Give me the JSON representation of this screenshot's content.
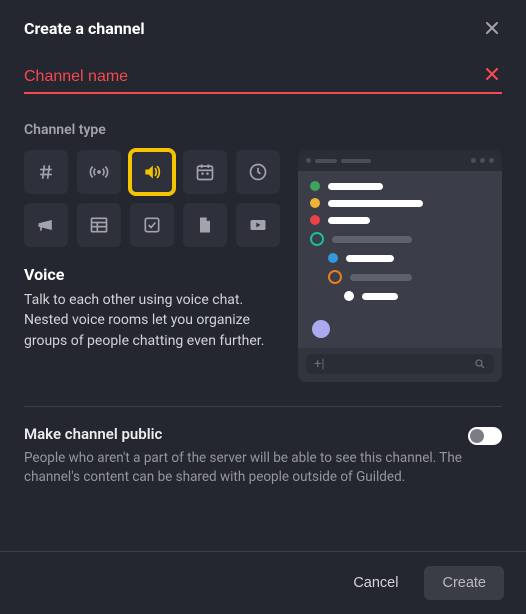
{
  "header": {
    "title": "Create a channel"
  },
  "name_input": {
    "placeholder": "Channel name",
    "value": ""
  },
  "section": {
    "channel_type_label": "Channel type"
  },
  "selected_type": {
    "title": "Voice",
    "description": "Talk to each other using voice chat. Nested voice rooms let you organize groups of people chatting even further."
  },
  "type_icons": [
    "hash-icon",
    "broadcast-icon",
    "voice-icon",
    "calendar-icon",
    "clock-icon",
    "announcement-icon",
    "board-icon",
    "checklist-icon",
    "docs-icon",
    "media-icon"
  ],
  "public": {
    "label": "Make channel public",
    "description": "People who aren't a part of the server will be able to see this channel. The channel's content can be shared with people outside of Guilded.",
    "enabled": false
  },
  "footer": {
    "cancel": "Cancel",
    "create": "Create"
  },
  "preview": {
    "input_left": "+|",
    "colors": {
      "green": "#3ba55d",
      "yellow": "#f0b232",
      "red": "#ed4245",
      "teal": "#1abc9c",
      "orange": "#e67e22",
      "blue": "#3498db",
      "purple": "#a9aaf0"
    }
  }
}
